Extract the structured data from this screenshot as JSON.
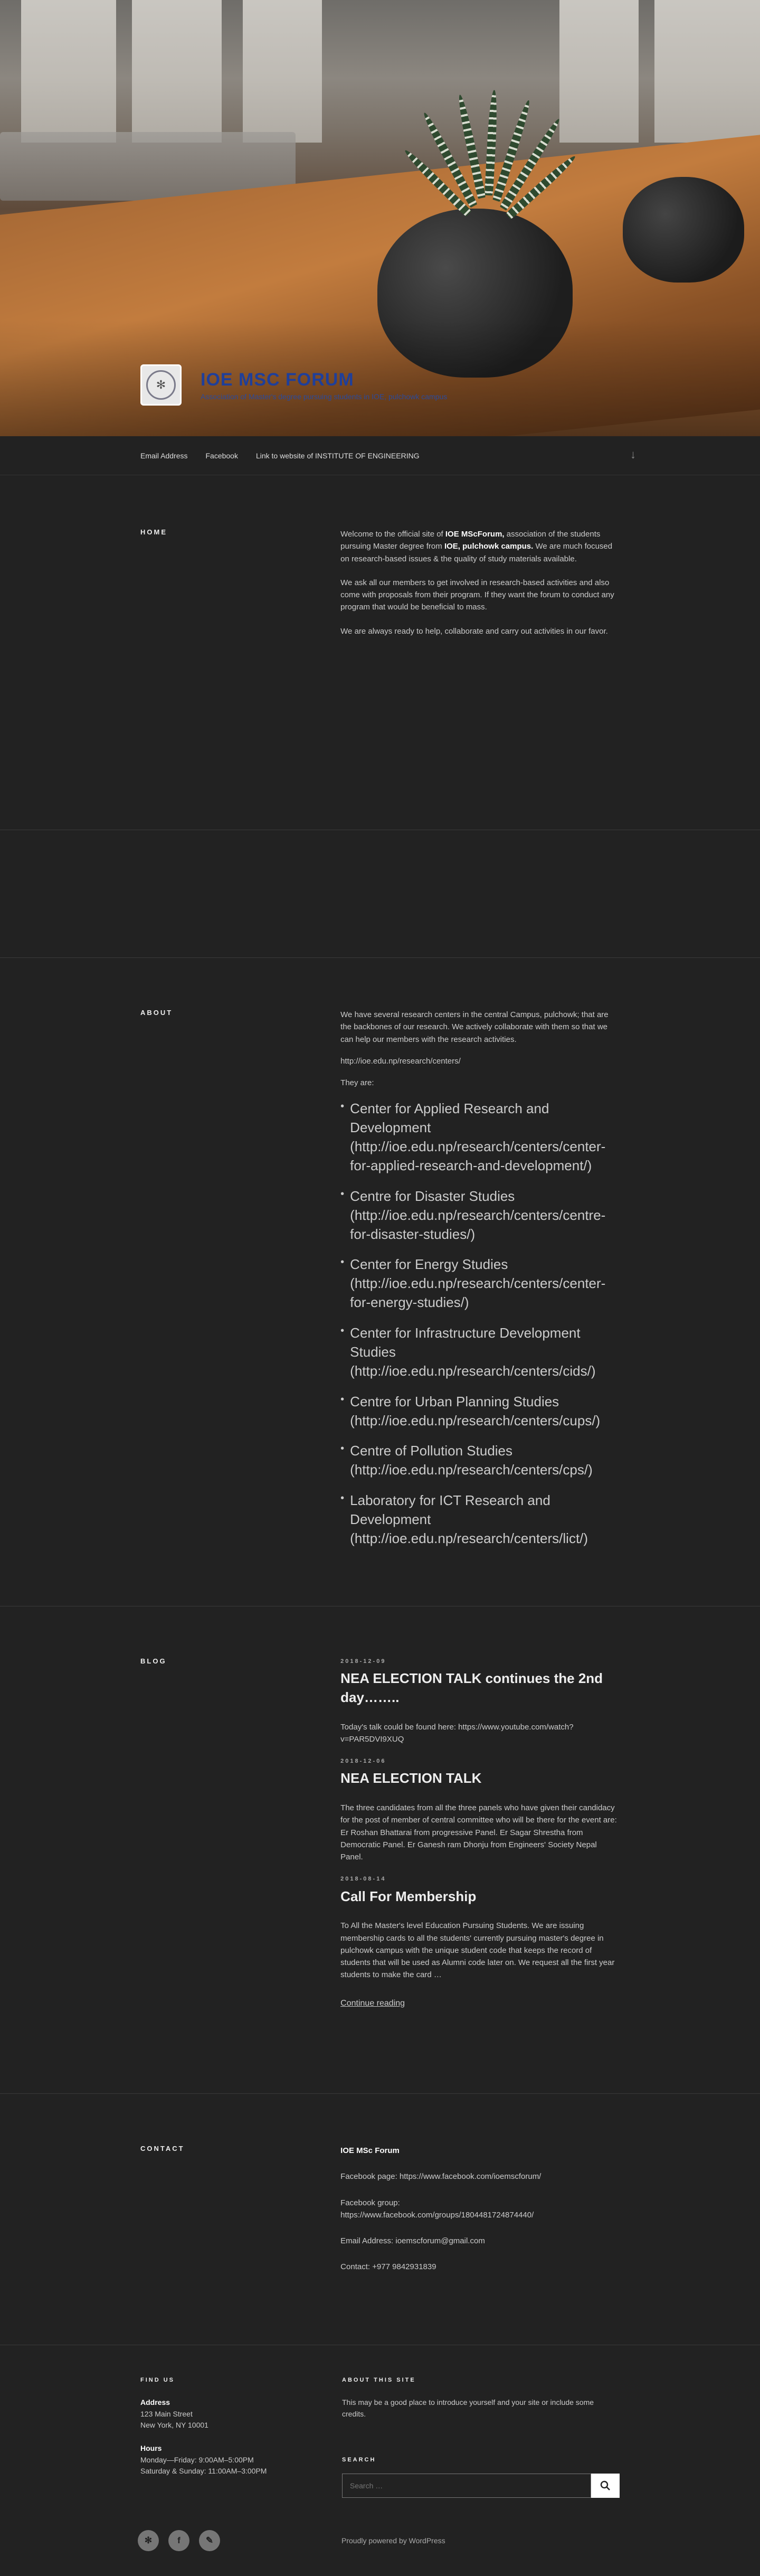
{
  "header": {
    "site_title": "IOE MSC FORUM",
    "tagline": "Association of Master's degree pursuing students in IOE, pulchowk campus"
  },
  "nav": {
    "items": [
      "Email Address",
      "Facebook",
      "Link to website of INSTITUTE OF ENGINEERING"
    ]
  },
  "home": {
    "title": "HOME",
    "p1_prefix": "Welcome to the official site of ",
    "p1_bold1": "IOE MScForum,",
    "p1_mid": "  association of the students pursuing Master degree from ",
    "p1_bold2": "IOE, pulchowk campus.",
    "p1_suffix": " We are much focused on research-based issues & the quality of study materials available.",
    "p2": "We ask all our members to get involved in research-based activities and also come with proposals from their program. If they want the forum to conduct any program that would be beneficial to mass.",
    "p3": "We are always ready to help, collaborate and carry out activities in our favor."
  },
  "about": {
    "title": "ABOUT",
    "p1": "We have several research centers in the central Campus, pulchowk; that are the backbones of our research. We actively collaborate with them so that we can help our members with the research activities.",
    "link": "http://ioe.edu.np/research/centers/",
    "they_are": "They are:",
    "centers": [
      "Center for Applied Research and Development (http://ioe.edu.np/research/centers/center-for-applied-research-and-development/)",
      "Centre for Disaster Studies (http://ioe.edu.np/research/centers/centre-for-disaster-studies/)",
      "Center for Energy Studies (http://ioe.edu.np/research/centers/center-for-energy-studies/)",
      "Center for Infrastructure Development Studies (http://ioe.edu.np/research/centers/cids/)",
      "Centre for Urban Planning Studies (http://ioe.edu.np/research/centers/cups/)",
      "Centre of Pollution Studies (http://ioe.edu.np/research/centers/cps/)",
      "Laboratory for ICT Research and Development (http://ioe.edu.np/research/centers/lict/)"
    ]
  },
  "blog": {
    "title": "BLOG",
    "posts": [
      {
        "date": "2018-12-09",
        "title": "NEA ELECTION TALK continues the 2nd day……..",
        "body": "Today's talk could be found here: https://www.youtube.com/watch?v=PAR5DVI9XUQ"
      },
      {
        "date": "2018-12-06",
        "title": "NEA ELECTION TALK",
        "body": "The three candidates from all the three panels who have given their candidacy for the post of member of central committee who will be there for the event are: Er Roshan Bhattarai from progressive Panel. Er Sagar Shrestha from Democratic Panel. Er Ganesh ram Dhonju from Engineers' Society Nepal Panel."
      },
      {
        "date": "2018-08-14",
        "title": "Call For Membership",
        "body": "To All the Master's level Education Pursuing Students. We are issuing membership cards to all the students' currently pursuing master's degree in pulchowk campus with the unique student code that keeps the record of students that will be used as Alumni code later on. We request all the first year students to make the card …"
      }
    ],
    "continue": "Continue reading"
  },
  "contact": {
    "title": "CONTACT",
    "heading": "IOE MSc Forum",
    "facebook_page": "Facebook page:      https://www.facebook.com/ioemscforum/",
    "facebook_group_label": "Facebook group:",
    "facebook_group": "https://www.facebook.com/groups/1804481724874440/",
    "email": "Email Address: ioemscforum@gmail.com",
    "phone": "Contact: +977 9842931839"
  },
  "footer": {
    "find_us_title": "FIND US",
    "address_label": "Address",
    "address_line1": "123 Main Street",
    "address_line2": "New York, NY 10001",
    "hours_label": "Hours",
    "hours_line1": "Monday—Friday: 9:00AM–5:00PM",
    "hours_line2": "Saturday & Sunday: 11:00AM–3:00PM",
    "about_title": "ABOUT THIS SITE",
    "about_text": "This may be a good place to introduce yourself and your site or include some credits.",
    "search_title": "SEARCH",
    "search_placeholder": "Search …",
    "powered": "Proudly powered by WordPress"
  }
}
